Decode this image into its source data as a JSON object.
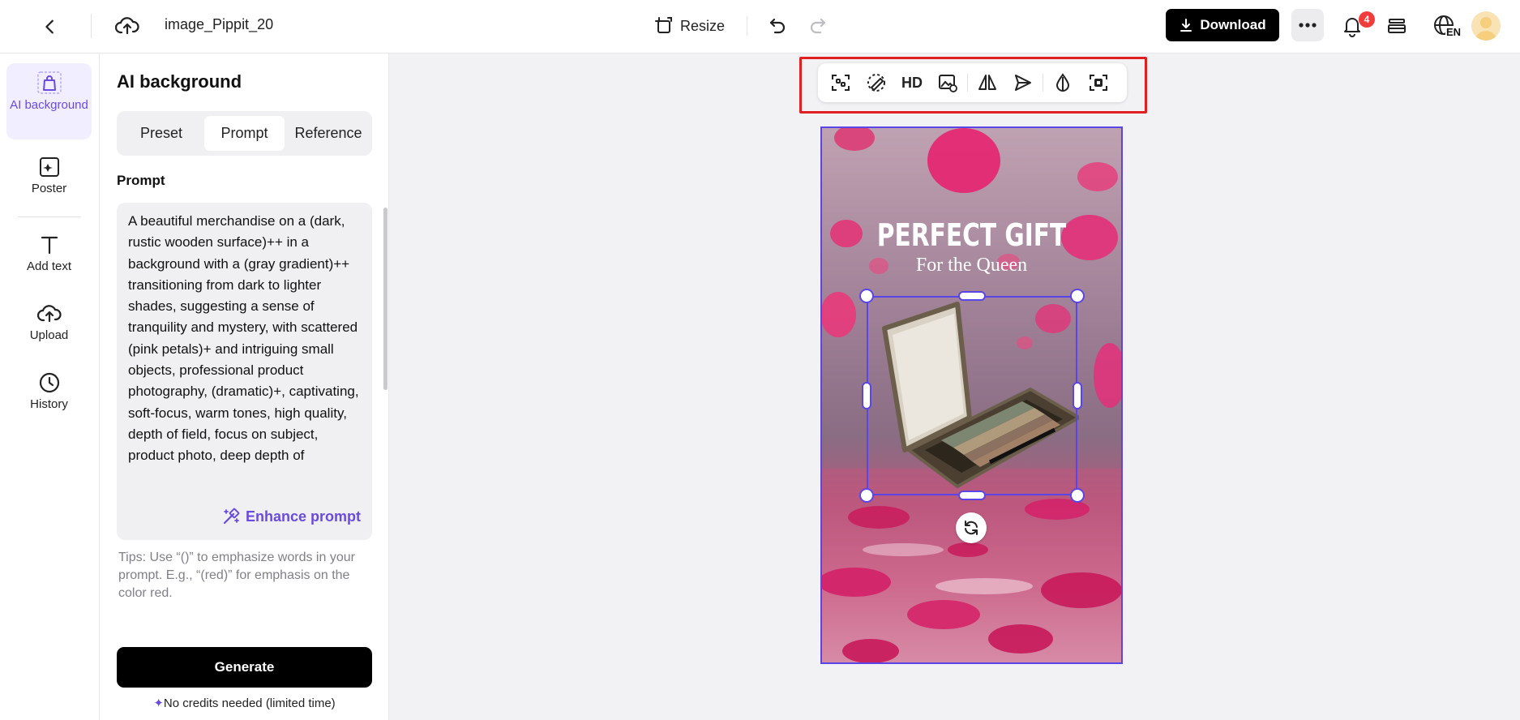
{
  "topbar": {
    "filename": "image_Pippit_20",
    "resize_label": "Resize",
    "download_label": "Download",
    "notification_count": "4",
    "language": "EN"
  },
  "leftnav": {
    "items": [
      {
        "label": "AI background",
        "icon": "bag-icon",
        "active": true
      },
      {
        "label": "Poster",
        "icon": "poster-icon"
      },
      {
        "label": "Add text",
        "icon": "text-icon"
      },
      {
        "label": "Upload",
        "icon": "upload-cloud-icon"
      },
      {
        "label": "History",
        "icon": "clock-icon"
      }
    ]
  },
  "panel": {
    "title": "AI background",
    "tabs": [
      "Preset",
      "Prompt",
      "Reference"
    ],
    "active_tab": "Prompt",
    "prompt_label": "Prompt",
    "prompt_text": "A beautiful merchandise on a (dark, rustic wooden surface)++ in a background with a (gray gradient)++ transitioning from dark to lighter shades, suggesting a sense of tranquility and mystery, with scattered (pink petals)+ and intriguing small objects, professional product photography, (dramatic)+, captivating, soft-focus, warm tones, high quality, depth of field, focus on subject, product photo, deep depth of",
    "enhance_label": "Enhance prompt",
    "tips": "Tips: Use “()” to emphasize words in your prompt. E.g., “(red)” for emphasis on the color red.",
    "generate_label": "Generate",
    "credits_note": "No credits needed (limited time)"
  },
  "floating_toolbar": {
    "items": [
      "cutout-icon",
      "magic-eraser-icon",
      "HD",
      "image-replace-icon",
      "flip-icon",
      "send-backward-icon",
      "opacity-icon",
      "focus-icon"
    ]
  },
  "poster": {
    "title": "PERFECT GIFT",
    "subtitle": "For the Queen"
  },
  "colors": {
    "accent": "#6a4be0",
    "selection": "#5a45e6",
    "highlight_frame": "#e02020",
    "badge": "#f23b3b"
  }
}
